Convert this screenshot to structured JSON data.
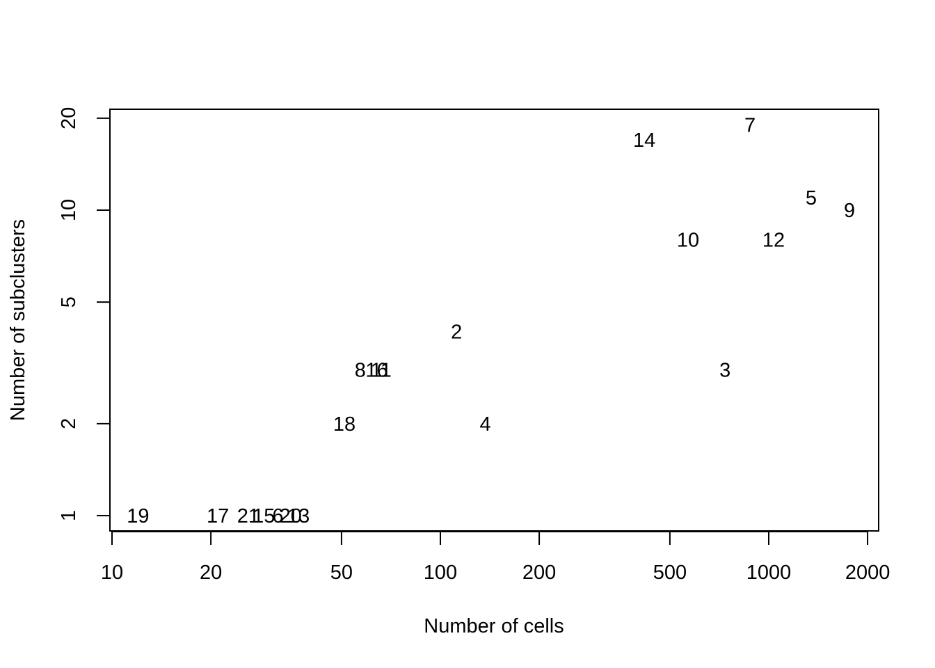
{
  "chart_data": {
    "type": "scatter",
    "title": "",
    "xlabel": "Number of cells",
    "ylabel": "Number of subclusters",
    "xscale": "log",
    "yscale": "log",
    "xlim": [
      10,
      2000
    ],
    "ylim": [
      1,
      20
    ],
    "x_ticks": [
      10,
      20,
      50,
      100,
      200,
      500,
      1000,
      2000
    ],
    "x_tick_labels": [
      "10",
      "20",
      "50",
      "100",
      "200",
      "500",
      "1000",
      "2000"
    ],
    "y_ticks": [
      1,
      2,
      5,
      10,
      20
    ],
    "y_tick_labels": [
      "1",
      "2",
      "5",
      "10",
      "20"
    ],
    "grid": false,
    "legend": null,
    "marker": "text-label",
    "points": [
      {
        "label": "19",
        "x": 12,
        "y": 1
      },
      {
        "label": "17",
        "x": 21,
        "y": 1
      },
      {
        "label": "21",
        "x": 26,
        "y": 1
      },
      {
        "label": "15",
        "x": 29,
        "y": 1
      },
      {
        "label": "6",
        "x": 32,
        "y": 1
      },
      {
        "label": "20",
        "x": 35,
        "y": 1
      },
      {
        "label": "13",
        "x": 37,
        "y": 1
      },
      {
        "label": "18",
        "x": 51,
        "y": 2
      },
      {
        "label": "8",
        "x": 57,
        "y": 3
      },
      {
        "label": "16",
        "x": 64,
        "y": 3
      },
      {
        "label": "11",
        "x": 66,
        "y": 3
      },
      {
        "label": "2",
        "x": 112,
        "y": 4
      },
      {
        "label": "4",
        "x": 137,
        "y": 2
      },
      {
        "label": "14",
        "x": 418,
        "y": 17
      },
      {
        "label": "10",
        "x": 568,
        "y": 8
      },
      {
        "label": "3",
        "x": 736,
        "y": 3
      },
      {
        "label": "7",
        "x": 877,
        "y": 19
      },
      {
        "label": "12",
        "x": 1035,
        "y": 8
      },
      {
        "label": "5",
        "x": 1346,
        "y": 11
      },
      {
        "label": "9",
        "x": 1762,
        "y": 10
      }
    ]
  }
}
